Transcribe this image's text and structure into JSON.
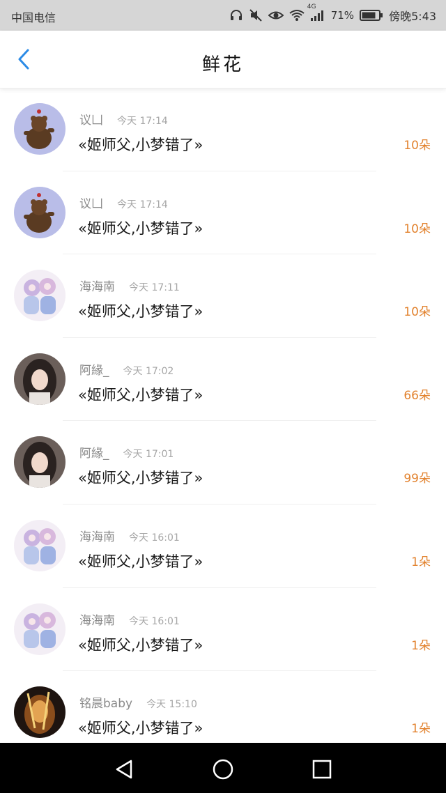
{
  "status": {
    "carrier": "中国电信",
    "network": "4G",
    "battery": "71%",
    "time": "傍晚5:43"
  },
  "nav": {
    "title": "鲜花"
  },
  "rows": [
    {
      "name": "议凵",
      "time": "今天 17:14",
      "msg": "«姬师父,小梦错了»",
      "count": "10朵"
    },
    {
      "name": "议凵",
      "time": "今天 17:14",
      "msg": "«姬师父,小梦错了»",
      "count": "10朵"
    },
    {
      "name": "海海南",
      "time": "今天 17:11",
      "msg": "«姬师父,小梦错了»",
      "count": "10朵"
    },
    {
      "name": "阿緣_",
      "time": "今天 17:02",
      "msg": "«姬师父,小梦错了»",
      "count": "66朵"
    },
    {
      "name": "阿緣_",
      "time": "今天 17:01",
      "msg": "«姬师父,小梦错了»",
      "count": "99朵"
    },
    {
      "name": "海海南",
      "time": "今天 16:01",
      "msg": "«姬师父,小梦错了»",
      "count": "1朵"
    },
    {
      "name": "海海南",
      "time": "今天 16:01",
      "msg": "«姬师父,小梦错了»",
      "count": "1朵"
    },
    {
      "name": "铭晨baby",
      "time": "今天 15:10",
      "msg": "«姬师父,小梦错了»",
      "count": "1朵"
    }
  ],
  "colors": {
    "accent": "#2b8be6",
    "count": "#e2822e"
  }
}
